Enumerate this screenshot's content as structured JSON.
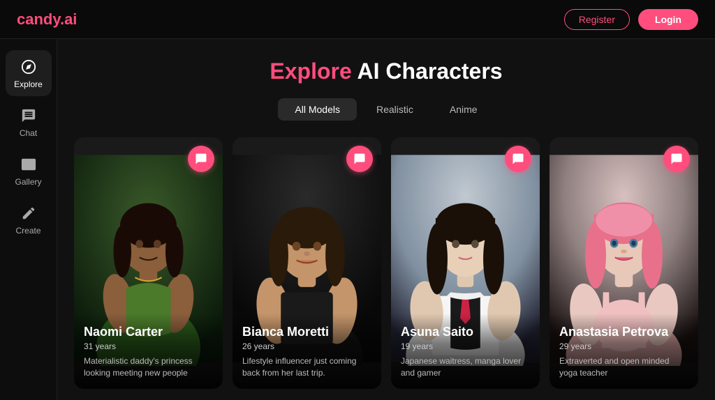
{
  "brand": {
    "name_prefix": "candy",
    "name_suffix": ".ai"
  },
  "header": {
    "register_label": "Register",
    "login_label": "Login"
  },
  "sidebar": {
    "items": [
      {
        "id": "explore",
        "label": "Explore",
        "active": true,
        "icon": "compass"
      },
      {
        "id": "chat",
        "label": "Chat",
        "active": false,
        "icon": "chat"
      },
      {
        "id": "gallery",
        "label": "Gallery",
        "active": false,
        "icon": "gallery"
      },
      {
        "id": "create",
        "label": "Create",
        "active": false,
        "icon": "pencil"
      }
    ]
  },
  "page": {
    "title_highlight": "Explore",
    "title_rest": " AI Characters"
  },
  "filters": [
    {
      "id": "all",
      "label": "All Models",
      "active": true
    },
    {
      "id": "realistic",
      "label": "Realistic",
      "active": false
    },
    {
      "id": "anime",
      "label": "Anime",
      "active": false
    }
  ],
  "characters": [
    {
      "id": 1,
      "name": "Naomi Carter",
      "age": "31 years",
      "description": "Materialistic daddy's princess looking meeting new people",
      "style": "realistic",
      "color_theme": "#2a4a1a"
    },
    {
      "id": 2,
      "name": "Bianca Moretti",
      "age": "26 years",
      "description": "Lifestyle influencer just coming back from her last trip.",
      "style": "realistic",
      "color_theme": "#1a1a1a"
    },
    {
      "id": 3,
      "name": "Asuna Saito",
      "age": "19 years",
      "description": "Japanese waitress, manga lover and gamer",
      "style": "anime",
      "color_theme": "#1a1a2a"
    },
    {
      "id": 4,
      "name": "Anastasia Petrova",
      "age": "29 years",
      "description": "Extraverted and open minded yoga teacher",
      "style": "realistic",
      "color_theme": "#2a1a1a"
    }
  ]
}
